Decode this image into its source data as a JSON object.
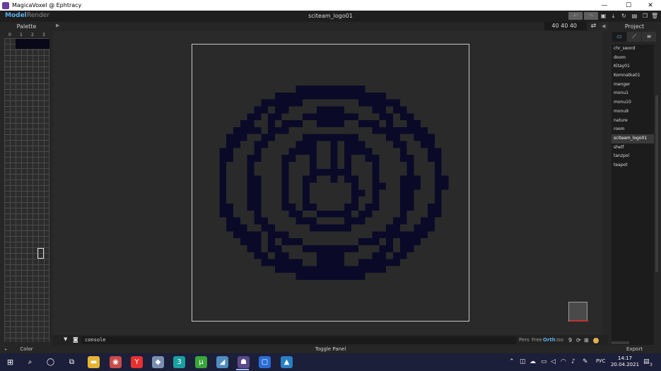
{
  "window": {
    "title": "MagicaVoxel @ Ephtracy",
    "minimize_glyph": "—",
    "maximize_glyph": "☐",
    "close_glyph": "✕"
  },
  "menu": {
    "model_tab": "Model",
    "render_tab": "Render",
    "filename": "sciteam_logo01",
    "undo_glyph": "↶",
    "redo_glyph": "↷"
  },
  "palette": {
    "title": "Palette",
    "columns": [
      "0",
      "1",
      "2",
      "3"
    ],
    "footer": "Color"
  },
  "view": {
    "dims": "40  40  40"
  },
  "console": {
    "placeholder": "console",
    "modes": [
      "Pers",
      "Free",
      "Orth",
      "Iso"
    ],
    "active_mode": "Orth",
    "zoom_value": "9"
  },
  "statusbar": {
    "toggle_label": "Toggle Panel"
  },
  "project": {
    "title": "Project",
    "export_label": "Export",
    "items": [
      "chr_sword",
      "doom",
      "Kitay01",
      "Komnatka01",
      "menger",
      "monu1",
      "monu10",
      "monu9",
      "nature",
      "room",
      "sciteam_logo01",
      "shelf",
      "tanzpol",
      "teapot"
    ],
    "selected": "sciteam_logo01"
  },
  "taskbar": {
    "lang": "РУС",
    "time": "14:17",
    "date": "20.04.2021",
    "notifications": "3"
  },
  "colors": {
    "accent": "#5aaeea",
    "voxel": "#0a0a28",
    "background": "#2a2a2a"
  }
}
